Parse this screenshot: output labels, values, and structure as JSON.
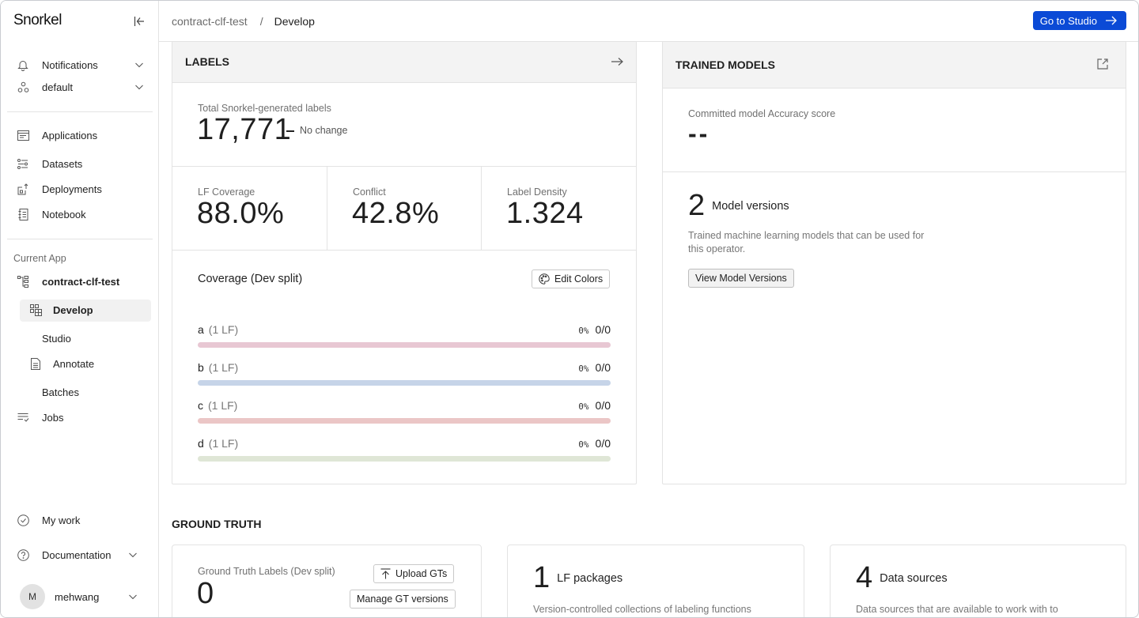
{
  "sidebar": {
    "logo": "Snorkel",
    "top_items": [
      {
        "label": "Notifications",
        "icon": "bell-icon",
        "has_chevron": true
      },
      {
        "label": "default",
        "icon": "workspace-icon",
        "has_chevron": true
      }
    ],
    "main_items": [
      {
        "label": "Applications",
        "icon": "applications-icon"
      },
      {
        "label": "Datasets",
        "icon": "datasets-icon"
      },
      {
        "label": "Deployments",
        "icon": "deployments-icon"
      },
      {
        "label": "Notebook",
        "icon": "notebook-icon"
      }
    ],
    "current_app_label": "Current App",
    "current_app": "contract-clf-test",
    "app_items": [
      {
        "label": "Develop",
        "icon": "develop-icon",
        "active": true
      },
      {
        "label": "Studio"
      },
      {
        "label": "Annotate",
        "icon": "document-icon"
      },
      {
        "label": "Batches"
      }
    ],
    "jobs": "Jobs",
    "my_work": "My work",
    "documentation": "Documentation",
    "user": {
      "initial": "M",
      "name": "mehwang"
    }
  },
  "header": {
    "breadcrumb": [
      "contract-clf-test",
      "Develop"
    ],
    "breadcrumb_sep": "/",
    "go_to_studio": "Go to Studio"
  },
  "labels_card": {
    "title": "LABELS",
    "total_label": "Total Snorkel-generated labels",
    "total_value": "17,771",
    "change": "No change",
    "metrics": [
      {
        "label": "LF Coverage",
        "value": "88.0%"
      },
      {
        "label": "Conflict",
        "value": "42.8%"
      },
      {
        "label": "Label Density",
        "value": "1.324"
      }
    ],
    "coverage_title": "Coverage (Dev split)",
    "edit_colors": "Edit Colors",
    "coverage": [
      {
        "name": "a",
        "lf": "(1 LF)",
        "pct": "0%",
        "ratio": "0/0",
        "fill": 0,
        "color": "#e8c7d3"
      },
      {
        "name": "b",
        "lf": "(1 LF)",
        "pct": "0%",
        "ratio": "0/0",
        "fill": 0,
        "color": "#c6d4e8"
      },
      {
        "name": "c",
        "lf": "(1 LF)",
        "pct": "0%",
        "ratio": "0/0",
        "fill": 0,
        "color": "#ebc6c6"
      },
      {
        "name": "d",
        "lf": "(1 LF)",
        "pct": "0%",
        "ratio": "0/0",
        "fill": 0,
        "color": "#dfe6d6"
      }
    ]
  },
  "models_card": {
    "title": "TRAINED MODELS",
    "accuracy_label": "Committed model Accuracy score",
    "accuracy_value": "--",
    "versions_count": "2",
    "versions_label": "Model versions",
    "versions_desc": "Trained machine learning models that can be used for this operator.",
    "view_button": "View Model Versions"
  },
  "ground_truth": {
    "title": "GROUND TRUTH",
    "gt_label": "Ground Truth Labels (Dev split)",
    "gt_value": "0",
    "upload": "Upload GTs",
    "manage": "Manage GT versions",
    "lf_count": "1",
    "lf_label": "LF packages",
    "lf_desc": "Version-controlled collections of labeling functions",
    "ds_count": "4",
    "ds_label": "Data sources",
    "ds_desc": "Data sources that are available to work with to"
  },
  "colors": {
    "primary": "#0b4ad6",
    "card_header": "#f3f3f3",
    "border": "#e3e3e3"
  }
}
